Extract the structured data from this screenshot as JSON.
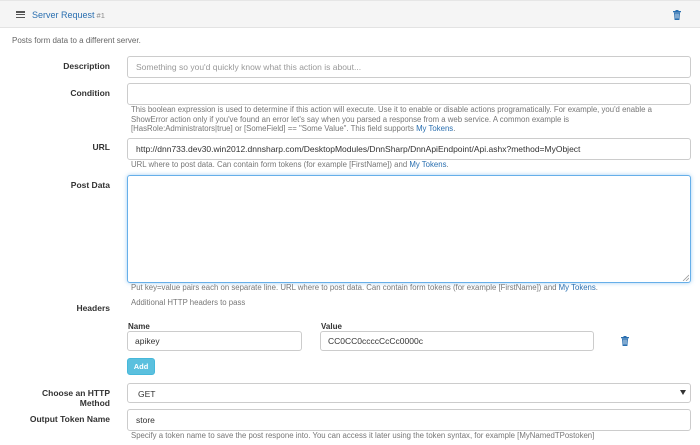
{
  "header": {
    "title": "Server Request",
    "number": "#1",
    "description": "Posts form data to a different server."
  },
  "fields": {
    "description": {
      "label": "Description",
      "placeholder": "Something so you'd quickly know what this action is about...",
      "value": ""
    },
    "condition": {
      "label": "Condition",
      "value": "",
      "help_line1": "This boolean expression is used to determine if this action will execute. Use it to enable or disable actions programatically. For example, you'd enable a",
      "help_line2": "ShowError action only if you've found an error let's say when you parsed a response from a web service. A common example is",
      "help_line3": "[HasRole:Administrators|true] or [SomeField] == \"Some Value\". This field supports ",
      "help_link": "My Tokens",
      "help_end": "."
    },
    "url": {
      "label": "URL",
      "value": "http://dnn733.dev30.win2012.dnnsharp.com/DesktopModules/DnnSharp/DnnApiEndpoint/Api.ashx?method=MyObject",
      "help": "URL where to post data. Can contain form tokens (for example [FirstName]) and ",
      "help_link": "My Tokens",
      "help_end": "."
    },
    "post_data": {
      "label": "Post Data",
      "value": "",
      "help": "Put key=value pairs each on separate line. URL where to post data. Can contain form tokens (for example [FirstName]) and ",
      "help_link": "My Tokens",
      "help_end": "."
    },
    "headers": {
      "label": "Headers",
      "help": "Additional HTTP headers to pass",
      "name_header": "Name",
      "value_header": "Value",
      "rows": [
        {
          "name": "apikey",
          "value": "CC0CC0ccccCcCc0000c"
        }
      ],
      "add_label": "Add"
    },
    "http_method": {
      "label": "Choose an HTTP Method",
      "selected": "GET"
    },
    "output_token": {
      "label": "Output Token Name",
      "value": "store",
      "help": "Specify a token name to save the post respone into. You can access it later using the token syntax, for example [MyNamedTPostoken]"
    }
  },
  "colors": {
    "link": "#2a6fb0",
    "add_button": "#5bc0de",
    "focus_border": "#66afe9"
  },
  "icons": {
    "menu": "menu-icon",
    "trash": "trash-icon",
    "caret": "chevron-down-icon"
  }
}
